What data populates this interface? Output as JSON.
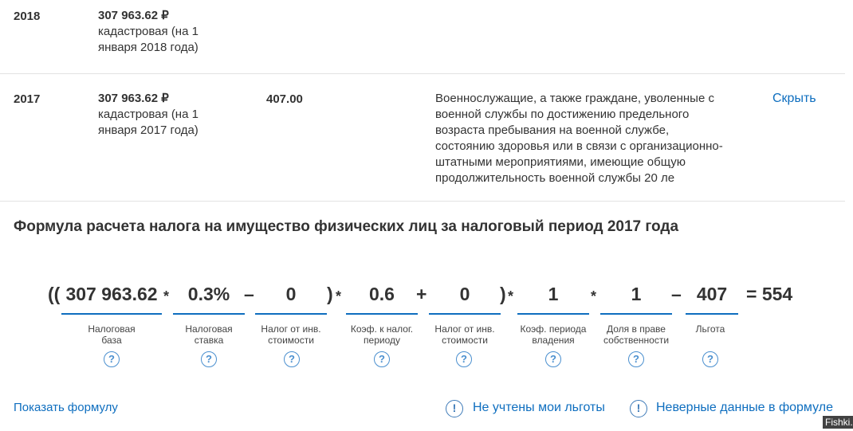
{
  "rows": [
    {
      "year": "2018",
      "amount": "307 963.62",
      "currency": "₽",
      "cadastral_line1": "кадастровая (на 1",
      "cadastral_line2": "января 2018 года)"
    },
    {
      "year": "2017",
      "amount": "307 963.62",
      "currency": "₽",
      "cadastral_line1": "кадастровая (на 1",
      "cadastral_line2": "января 2017 года)",
      "benefit_sum": "407.00",
      "benefit_lines": [
        "Военнослужащие, а также граждане, уволенные с",
        "военной службы по достижению предельного",
        "возраста пребывания на военной службе,",
        "состоянию здоровья или в связи с организационно-",
        "штатными мероприятиями, имеющие общую",
        "продолжительность военной службы 20 ле"
      ],
      "hide_label": "Скрыть"
    }
  ],
  "formula": {
    "title": "Формула расчета налога на имущество физических лиц за налоговый период 2017 года",
    "open_parens": "((",
    "values": {
      "tax_base": "307 963.62",
      "tax_rate": "0.3%",
      "inv_cost_1": "0",
      "period_coef": "0.6",
      "inv_cost_2": "0",
      "ownership_period_coef": "1",
      "ownership_share": "1",
      "benefit": "407"
    },
    "operators": {
      "mult": "*",
      "minus": "–",
      "close_paren": ")",
      "plus": "+",
      "equals": "= 554"
    },
    "labels": {
      "tax_base": [
        "Налоговая",
        "база"
      ],
      "tax_rate": [
        "Налоговая",
        "ставка"
      ],
      "inv_cost_1": [
        "Налог от инв.",
        "стоимости"
      ],
      "period_coef": [
        "Коэф. к налог.",
        "периоду"
      ],
      "inv_cost_2": [
        "Налог от инв.",
        "стоимости"
      ],
      "ownership_period_coef": [
        "Коэф. периода",
        "владения"
      ],
      "ownership_share": [
        "Доля в праве",
        "собственности"
      ],
      "benefit": [
        "Льгота"
      ]
    },
    "help_glyph": "?"
  },
  "footer": {
    "show_formula": "Показать формулу",
    "warn_glyph": "!",
    "no_benefits": "Не учтены мои льготы",
    "wrong_data": "Неверные данные в формуле"
  },
  "watermark": "Fishki.net",
  "colors": {
    "link": "#0e6ebf",
    "text": "#333333",
    "divider": "#e3e3e3"
  }
}
